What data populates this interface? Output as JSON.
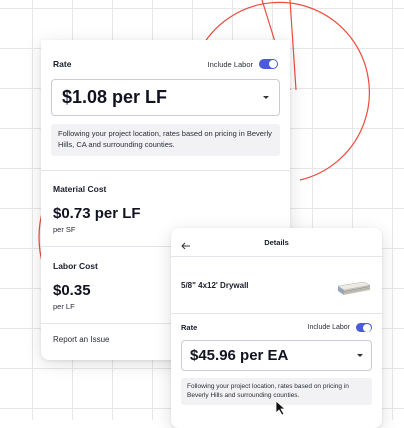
{
  "panel": {
    "rate_label": "Rate",
    "include_labor_label": "Include Labor",
    "include_labor_on": true,
    "rate_value": "$1.08 per LF",
    "rate_note": "Following your project location, rates based on pricing in Beverly Hills, CA and surrounding counties.",
    "material_cost_label": "Material Cost",
    "material_cost_value": "$0.73 per LF",
    "material_cost_unit": "per SF",
    "labor_cost_label": "Labor Cost",
    "labor_cost_value": "$0.35",
    "labor_cost_unit": "per LF",
    "report_issue_label": "Report an Issue"
  },
  "details": {
    "back_icon": "arrow-left-icon",
    "title": "Details",
    "product_name": "5/8\" 4x12' Drywall",
    "rate_label": "Rate",
    "include_labor_label": "Include Labor",
    "include_labor_on": true,
    "rate_value": "$45.96 per EA",
    "rate_note": "Following your project location, rates based on pricing in Beverly Hills and surrounding counties."
  },
  "colors": {
    "accent": "#4a5bdc",
    "decor_line": "#ef4b3c",
    "grid": "#e7e7ea"
  }
}
